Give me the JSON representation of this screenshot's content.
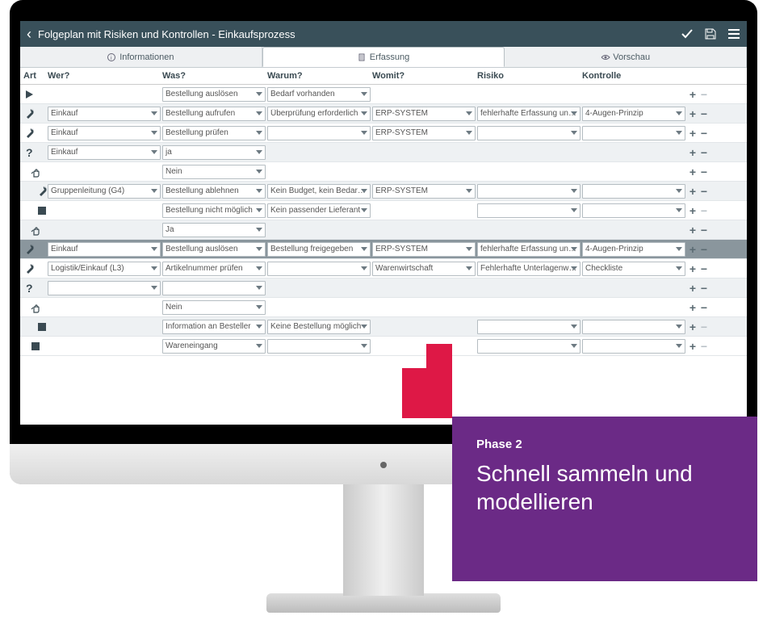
{
  "header": {
    "title": "Folgeplan mit Risiken und Kontrollen - Einkaufsprozess"
  },
  "tabs": [
    {
      "label": "Informationen",
      "icon": "info"
    },
    {
      "label": "Erfassung",
      "icon": "doc",
      "active": true
    },
    {
      "label": "Vorschau",
      "icon": "eye"
    }
  ],
  "columns": {
    "art": "Art",
    "wer": "Wer?",
    "was": "Was?",
    "warum": "Warum?",
    "womit": "Womit?",
    "risiko": "Risiko",
    "kontrolle": "Kontrolle"
  },
  "rows": [
    {
      "art": "play",
      "ind": 0,
      "wer": null,
      "was": "Bestellung auslösen",
      "warum": "Bedarf vorhanden",
      "womit": null,
      "risiko": null,
      "kontrolle": null,
      "pm": "gray",
      "even": false
    },
    {
      "art": "wrench",
      "ind": 0,
      "wer": "Einkauf",
      "was": "Bestellung aufrufen",
      "warum": "Überprüfung erforderlich",
      "womit": "ERP-SYSTEM",
      "risiko": "fehlerhafte Erfassung und Bearbeitung",
      "kontrolle": "4-Augen-Prinzip",
      "even": true
    },
    {
      "art": "wrench",
      "ind": 0,
      "wer": "Einkauf",
      "was": "Bestellung prüfen",
      "warum": "",
      "womit": "ERP-SYSTEM",
      "risiko": "",
      "kontrolle": "",
      "even": false
    },
    {
      "art": "question",
      "ind": 0,
      "wer": "Einkauf",
      "was": "ja",
      "warum": null,
      "womit": null,
      "risiko": null,
      "kontrolle": null,
      "even": true
    },
    {
      "art": "hand",
      "ind": 1,
      "wer": null,
      "was": "Nein",
      "warum": null,
      "womit": null,
      "risiko": null,
      "kontrolle": null,
      "even": false
    },
    {
      "art": "wrench",
      "ind": 2,
      "wer": "Gruppenleitung (G4)",
      "was": "Bestellung ablehnen",
      "warum": "Kein Budget, kein Bedarf, etc.",
      "womit": "ERP-SYSTEM",
      "risiko": "",
      "kontrolle": "",
      "even": true
    },
    {
      "art": "stop",
      "ind": 2,
      "wer": null,
      "was": "Bestellung nicht möglich",
      "warum": "Kein passender Lieferant",
      "womit": null,
      "risiko": "",
      "kontrolle": "",
      "pm": "gray",
      "even": false
    },
    {
      "art": "hand",
      "ind": 1,
      "wer": null,
      "was": "Ja",
      "warum": null,
      "womit": null,
      "risiko": null,
      "kontrolle": null,
      "even": true
    },
    {
      "art": "wrench",
      "ind": 0,
      "wer": "Einkauf",
      "was": "Bestellung auslösen",
      "warum": "Bestellung freigegeben",
      "womit": "ERP-SYSTEM",
      "risiko": "fehlerhafte Erfassung und Bearbeitung",
      "kontrolle": "4-Augen-Prinzip",
      "sel": true
    },
    {
      "art": "wrench",
      "ind": 0,
      "wer": "Logistik/Einkauf (L3)",
      "was": "Artikelnummer prüfen",
      "warum": "",
      "womit": "Warenwirtschaft",
      "risiko": "Fehlerhafte Unterlagenweiterleitung",
      "kontrolle": "Checkliste",
      "even": false
    },
    {
      "art": "question",
      "ind": 0,
      "wer": "",
      "was": "",
      "warum": null,
      "womit": null,
      "risiko": null,
      "kontrolle": null,
      "even": true
    },
    {
      "art": "hand",
      "ind": 1,
      "wer": null,
      "was": "Nein",
      "warum": null,
      "womit": null,
      "risiko": null,
      "kontrolle": null,
      "even": false
    },
    {
      "art": "stop",
      "ind": 2,
      "wer": null,
      "was": "Information an Besteller",
      "warum": "Keine Bestellung möglich",
      "womit": null,
      "risiko": "",
      "kontrolle": "",
      "pm": "gray",
      "even": true
    },
    {
      "art": "stop",
      "ind": 1,
      "wer": null,
      "was": "Wareneingang",
      "warum": "",
      "womit": null,
      "risiko": "",
      "kontrolle": "",
      "pm": "gray",
      "even": false
    }
  ],
  "card": {
    "phase": "Phase 2",
    "text": "Schnell sammeln und modellieren"
  }
}
